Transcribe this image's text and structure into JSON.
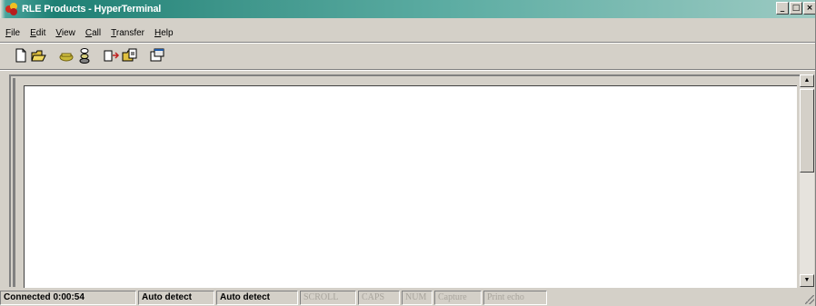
{
  "window": {
    "title": "RLE Products - HyperTerminal",
    "controls": {
      "minimize": "_",
      "maximize": "□",
      "close": "×"
    }
  },
  "menu": [
    {
      "key": "F",
      "rest": "ile"
    },
    {
      "key": "E",
      "rest": "dit"
    },
    {
      "key": "V",
      "rest": "iew"
    },
    {
      "key": "C",
      "rest": "all"
    },
    {
      "key": "T",
      "rest": "ransfer"
    },
    {
      "key": "H",
      "rest": "elp"
    }
  ],
  "toolbar": {
    "icons": [
      "new-icon",
      "open-icon",
      "connect-icon",
      "disconnect-icon",
      "send-icon",
      "receive-icon",
      "properties-icon"
    ]
  },
  "terminal": {
    "content": ""
  },
  "status": {
    "connected": "Connected 0:00:54",
    "detect1": "Auto detect",
    "detect2": "Auto detect",
    "scroll": "SCROLL",
    "caps": "CAPS",
    "num": "NUM",
    "capture": "Capture",
    "print_echo": "Print echo"
  },
  "colors": {
    "title_bar": "#1e8074",
    "chrome": "#d4d0c8",
    "terminal_bg": "#ffffff",
    "dim_text": "#a8a49c"
  }
}
